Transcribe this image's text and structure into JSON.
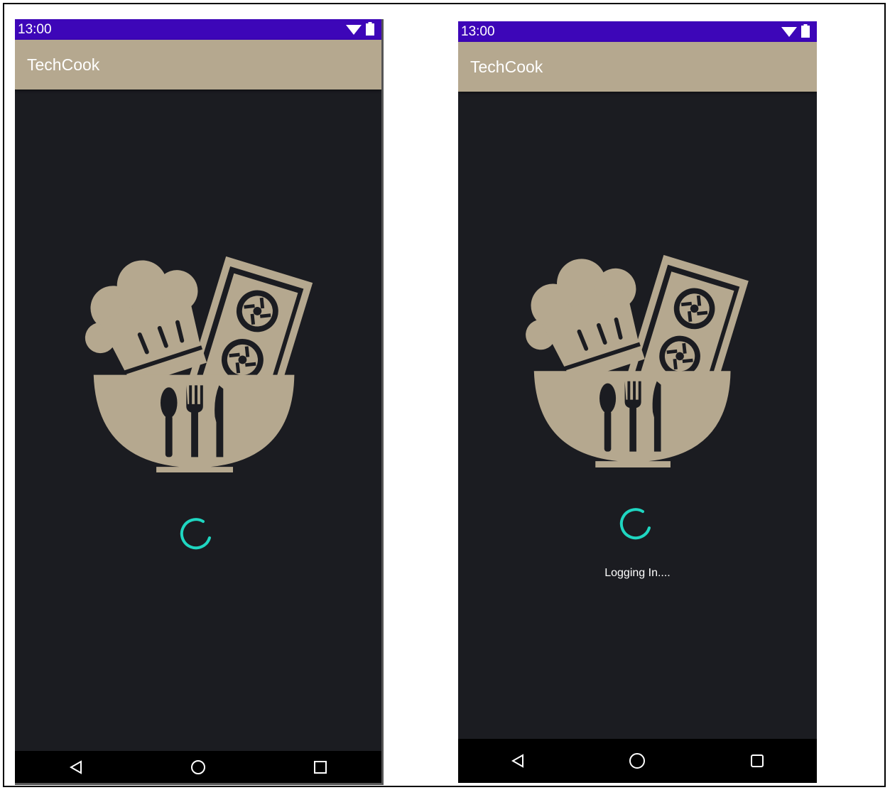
{
  "theme": {
    "status_bar_color": "#3d06b8",
    "app_bar_color": "#b5a88f",
    "background_color": "#1b1c21",
    "accent_color": "#1fd6c1",
    "logo_color": "#b5a88f"
  },
  "screens": [
    {
      "status_bar": {
        "time": "13:00",
        "icons": [
          "wifi-icon",
          "battery-icon"
        ]
      },
      "app_bar": {
        "title": "TechCook"
      },
      "logo": "chef-hat-bowl-logo",
      "progress": "spinner",
      "nav_bar": {
        "buttons": [
          "back-icon",
          "home-icon",
          "recents-icon"
        ]
      }
    },
    {
      "status_bar": {
        "time": "13:00",
        "icons": [
          "wifi-icon",
          "battery-icon"
        ]
      },
      "app_bar": {
        "title": "TechCook"
      },
      "logo": "chef-hat-bowl-logo",
      "progress": "spinner",
      "loading_text": "Logging In....",
      "nav_bar": {
        "buttons": [
          "back-icon",
          "home-icon",
          "recents-icon"
        ]
      }
    }
  ]
}
